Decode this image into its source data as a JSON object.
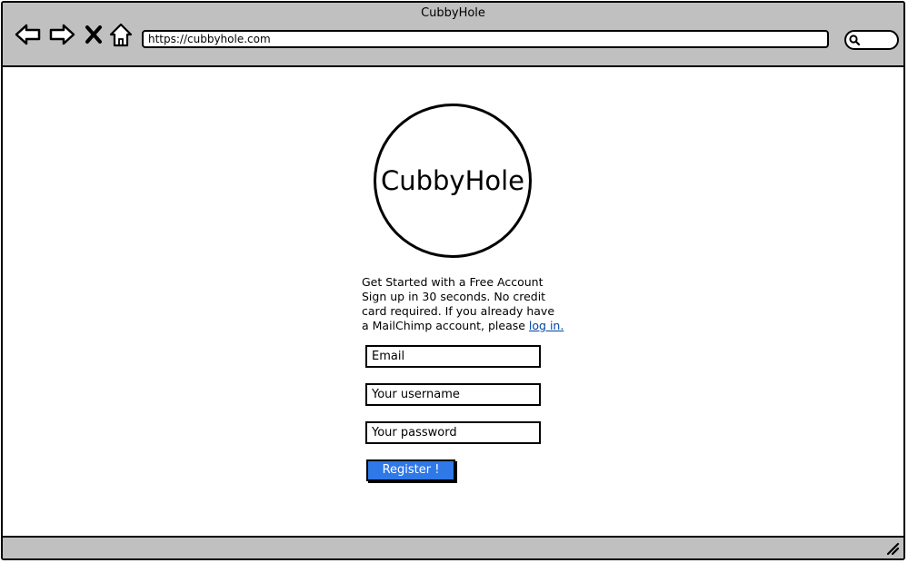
{
  "window": {
    "title": "CubbyHole",
    "url": "https://cubbyhole.com"
  },
  "nav": {
    "back_icon": "back-arrow-icon",
    "forward_icon": "forward-arrow-icon",
    "stop_icon": "close-x-icon",
    "home_icon": "home-icon",
    "search_icon": "search-icon"
  },
  "logo": {
    "text": "CubbyHole"
  },
  "intro": {
    "line1": "Get Started with a Free Account",
    "line2": "Sign up in 30 seconds. No credit",
    "line3": "card required. If you already have",
    "line4_prefix": "a MailChimp account, please ",
    "login_link": "log in."
  },
  "form": {
    "email_placeholder": "Email",
    "username_placeholder": "Your username",
    "password_placeholder": "Your password",
    "register_label": "Register !"
  },
  "colors": {
    "chrome": "#c0c0c0",
    "register_button": "#2f78e8",
    "link": "#0044aa"
  }
}
